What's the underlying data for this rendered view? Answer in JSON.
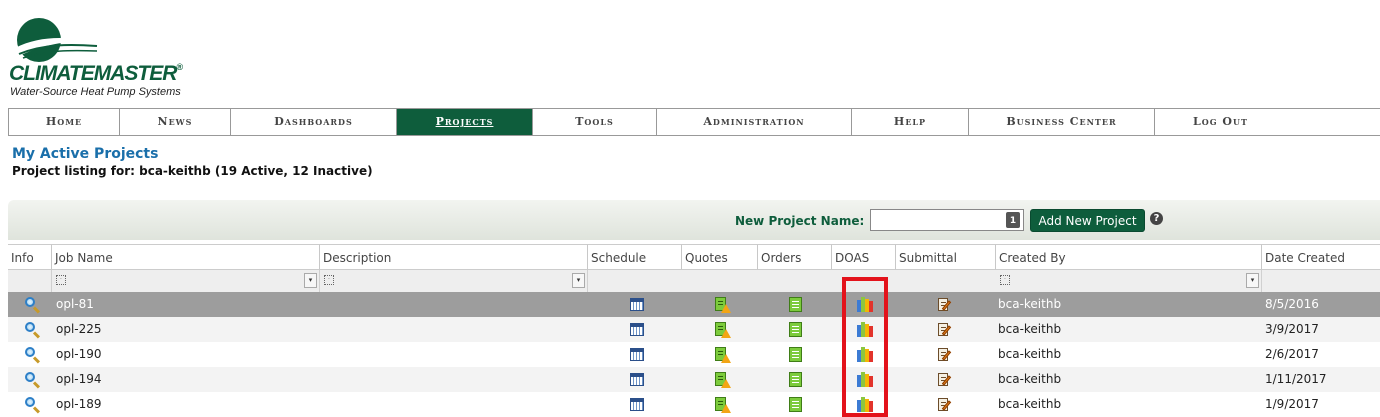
{
  "logo": {
    "wordmark": "CLIMATEMASTER",
    "registered": "®",
    "tagline": "Water-Source Heat Pump Systems"
  },
  "nav": {
    "items": [
      {
        "label": "Home",
        "active": false
      },
      {
        "label": "News",
        "active": false
      },
      {
        "label": "Dashboards",
        "active": false
      },
      {
        "label": "Projects",
        "active": true
      },
      {
        "label": "Tools",
        "active": false
      },
      {
        "label": "Administration",
        "active": false
      },
      {
        "label": "Help",
        "active": false
      },
      {
        "label": "Business Center",
        "active": false
      },
      {
        "label": "Log Out",
        "active": false
      }
    ]
  },
  "page": {
    "title": "My Active Projects",
    "subtitle": "Project listing for: bca-keithb (19 Active, 12 Inactive)"
  },
  "toolbar": {
    "new_project_label": "New Project Name:",
    "new_project_value": "",
    "field_badge": "1",
    "add_button": "Add New Project",
    "help": "?"
  },
  "grid": {
    "columns": [
      "Info",
      "Job Name",
      "Description",
      "Schedule",
      "Quotes",
      "Orders",
      "DOAS",
      "Submittal",
      "Created By",
      "Date Created"
    ],
    "filter_dropdown_glyph": "▾",
    "rows": [
      {
        "job_name": "opl-81",
        "created_by": "bca-keithb",
        "date_created": "8/5/2016",
        "selected": true
      },
      {
        "job_name": "opl-225",
        "created_by": "bca-keithb",
        "date_created": "3/9/2017",
        "selected": false
      },
      {
        "job_name": "opl-190",
        "created_by": "bca-keithb",
        "date_created": "2/6/2017",
        "selected": false
      },
      {
        "job_name": "opl-194",
        "created_by": "bca-keithb",
        "date_created": "1/11/2017",
        "selected": false
      },
      {
        "job_name": "opl-189",
        "created_by": "bca-keithb",
        "date_created": "1/9/2017",
        "selected": false
      }
    ]
  },
  "icons": {
    "info": "magnifier-icon",
    "schedule": "calendar-icon",
    "quotes": "quote-warning-icon",
    "orders": "order-sheet-icon",
    "doas": "doas-binders-icon",
    "submittal": "submittal-edit-icon"
  },
  "colors": {
    "brand": "#0e5d3c",
    "title": "#1a6faa",
    "highlight": "#e3121b",
    "selected_row": "#9d9d9d"
  }
}
